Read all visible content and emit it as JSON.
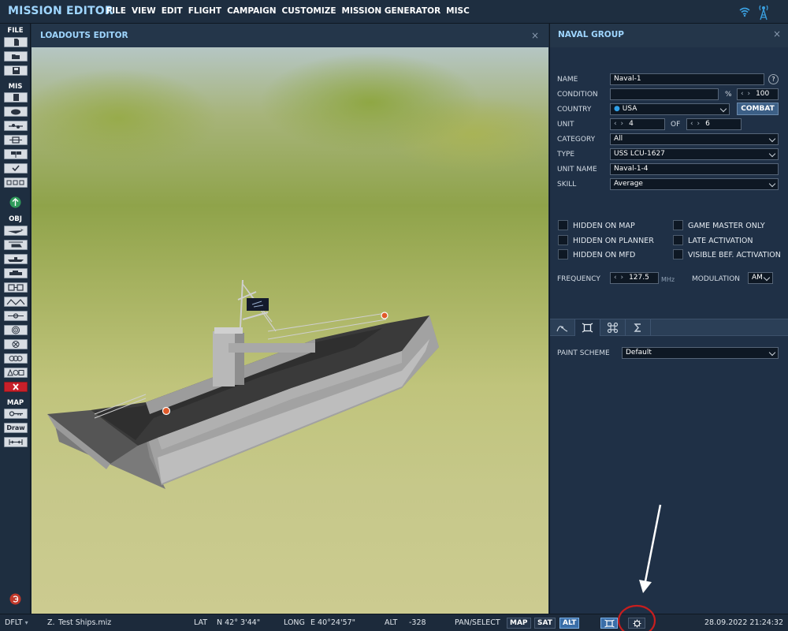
{
  "app": {
    "title": "MISSION EDITOR",
    "menu": [
      "FILE",
      "VIEW",
      "EDIT",
      "FLIGHT",
      "CAMPAIGN",
      "CUSTOMIZE",
      "MISSION GENERATOR",
      "MISC"
    ]
  },
  "leftbar": {
    "sections": [
      "FILE",
      "MIS",
      "OBJ",
      "MAP"
    ],
    "draw_label": "Draw"
  },
  "loadouts": {
    "title": "LOADOUTS EDITOR",
    "close": "×"
  },
  "naval": {
    "title": "NAVAL GROUP",
    "close": "×",
    "labels": {
      "name": "NAME",
      "condition": "CONDITION",
      "country": "COUNTRY",
      "unit": "UNIT",
      "of": "OF",
      "category": "CATEGORY",
      "type": "TYPE",
      "unit_name": "UNIT NAME",
      "skill": "SKILL",
      "frequency": "FREQUENCY",
      "modulation": "MODULATION",
      "paint_scheme": "PAINT SCHEME"
    },
    "values": {
      "name": "Naval-1",
      "condition": "",
      "condition_pct": "%",
      "condition_value": "100",
      "country": "USA",
      "unit": "4",
      "unit_of": "6",
      "category": "All",
      "type": "USS LCU-1627",
      "unit_name": "Naval-1-4",
      "skill": "Average",
      "frequency": "127.5",
      "frequency_unit": "MHz",
      "modulation": "AM",
      "paint_scheme": "Default"
    },
    "combat_button": "COMBAT",
    "help": "?",
    "checkboxes": [
      {
        "label": "HIDDEN ON MAP",
        "checked": false
      },
      {
        "label": "HIDDEN ON PLANNER",
        "checked": false
      },
      {
        "label": "HIDDEN ON MFD",
        "checked": false
      },
      {
        "label": "GAME MASTER ONLY",
        "checked": false
      },
      {
        "label": "LATE ACTIVATION",
        "checked": false
      },
      {
        "label": "VISIBLE BEF. ACTIVATION",
        "checked": false
      }
    ],
    "tabs": [
      "route-icon",
      "loadout-icon",
      "command-icon",
      "sigma-icon"
    ],
    "active_tab": 1
  },
  "status": {
    "profile": "DFLT",
    "mission_prefix": "Z.",
    "mission_file": "Test Ships.miz",
    "lat_label": "LAT",
    "lat_value": "N 42° 3'44\"",
    "long_label": "LONG",
    "long_value": "E 40°24'57\"",
    "alt_label": "ALT",
    "alt_value": "-328",
    "mode": "PAN/SELECT",
    "map_btn": "MAP",
    "sat_btn": "SAT",
    "alt_btn": "ALT",
    "datetime": "28.09.2022 21:24:32"
  },
  "colors": {
    "accent": "#9fd6ff",
    "panel": "#24364a",
    "active_button": "#3a6ea8",
    "annotation_red": "#c81e1e"
  }
}
